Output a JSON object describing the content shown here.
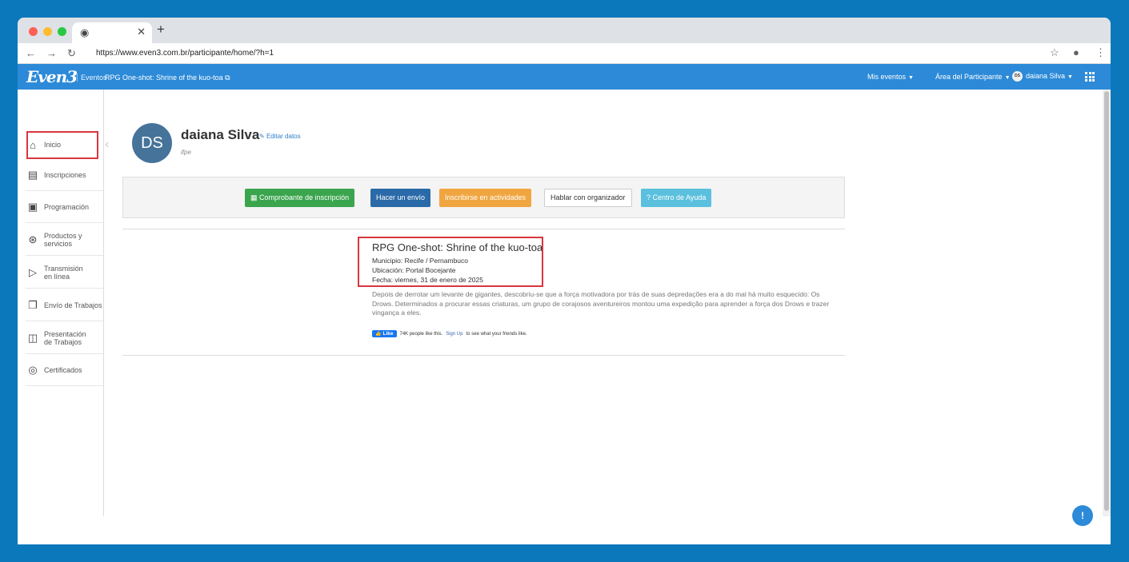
{
  "browser": {
    "tab_favicon": "chrome-icon",
    "url": "https://www.even3.com.br/participante/home/?h=1"
  },
  "topbar": {
    "logo": "Even3",
    "events_link": "Eventos",
    "event_name": "RPG One-shot: Shrine of the kuo-toa",
    "my_events": "Mis eventos",
    "participant_area": "Área del Participante",
    "user_initials": "DS",
    "user_name": "daiana Silva"
  },
  "sidebar": {
    "items": [
      {
        "label": "Inicio",
        "icon": "home-icon"
      },
      {
        "label": "Inscripciones",
        "icon": "ticket-icon"
      },
      {
        "label": "Programación",
        "icon": "calendar-icon"
      },
      {
        "label": "Productos y servicios",
        "icon": "cart-icon"
      },
      {
        "label": "Transmisión en línea",
        "icon": "play-icon"
      },
      {
        "label": "Envío de Trabajos",
        "icon": "documents-icon"
      },
      {
        "label": "Presentación de Trabajos",
        "icon": "presentation-icon"
      },
      {
        "label": "Certificados",
        "icon": "certificate-icon"
      }
    ]
  },
  "profile": {
    "initials": "DS",
    "name": "daiana Silva",
    "edit": "Editar datos",
    "institution": "ifpe"
  },
  "actions": {
    "receipt": "Comprobante de inscripción",
    "submit": "Hacer un envío",
    "activities": "Inscribirse en actividades",
    "contact": "Hablar con organizador",
    "help": "Centro de Ayuda"
  },
  "event": {
    "title": "RPG One-shot: Shrine of the kuo-toa",
    "municipality": "Municipio: Recife / Pernambuco",
    "location": "Ubicación: Portal Bocejante",
    "date": "Fecha: viernes, 31 de enero de 2025",
    "description": "Depois de derrotar um levante de gigantes, descobriu-se que a força motivadora por trás de suas depredações era a do mal há muito esquecido: Os Drows. Determinados a procurar essas criaturas, um grupo de corajosos aventureiros montou uma expedição para aprender a força dos Drows e trazer vingança a eles.",
    "like_label": "Like",
    "like_count": "74K people like this.",
    "signup": "Sign Up",
    "like_suffix": "to see what your friends like."
  },
  "colors": {
    "page_bg": "#0b78bb",
    "topbar": "#2c8ad8",
    "btn_green": "#3aa54d",
    "btn_blue": "#2a6aa8",
    "btn_orange": "#f0a640",
    "btn_cyan": "#5bc0de",
    "highlight": "#d9363e"
  }
}
